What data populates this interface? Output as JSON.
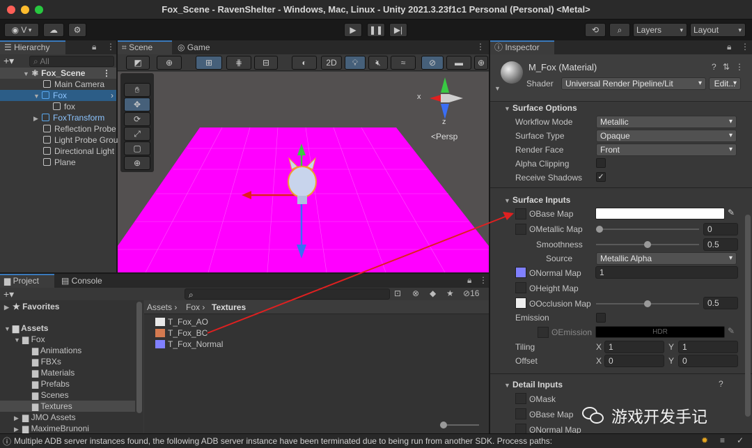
{
  "window_title": "Fox_Scene - RavenShelter - Windows, Mac, Linux - Unity 2021.3.23f1c1 Personal (Personal) <Metal>",
  "toolbar": {
    "account": "V",
    "layers": "Layers",
    "layout": "Layout"
  },
  "hierarchy": {
    "tab": "Hierarchy",
    "search_placeholder": "All",
    "scene": "Fox_Scene",
    "items": [
      "Main Camera",
      "Fox",
      "fox",
      "FoxTransform",
      "Reflection Probe",
      "Light Probe Grou",
      "Directional Light",
      "Plane"
    ]
  },
  "scene": {
    "tab_scene": "Scene",
    "tab_game": "Game",
    "mode_2d": "2D",
    "persp": "<Persp",
    "axis_x": "x",
    "axis_z": "z"
  },
  "project": {
    "tab_project": "Project",
    "tab_console": "Console",
    "hidden_count": "16",
    "favorites": "Favorites",
    "assets": "Assets",
    "tree": [
      "Fox",
      "Animations",
      "FBXs",
      "Materials",
      "Prefabs",
      "Scenes",
      "Textures",
      "JMO Assets",
      "MaximeBrunoni"
    ],
    "breadcrumb": [
      "Assets",
      "Fox",
      "Textures"
    ],
    "files": [
      "T_Fox_AO",
      "T_Fox_BC",
      "T_Fox_Normal"
    ]
  },
  "inspector": {
    "tab": "Inspector",
    "material_name": "M_Fox (Material)",
    "shader_label": "Shader",
    "shader_value": "Universal Render Pipeline/Lit",
    "edit_button": "Edit...",
    "surface_options": "Surface Options",
    "workflow_mode_label": "Workflow Mode",
    "workflow_mode_value": "Metallic",
    "surface_type_label": "Surface Type",
    "surface_type_value": "Opaque",
    "render_face_label": "Render Face",
    "render_face_value": "Front",
    "alpha_clipping_label": "Alpha Clipping",
    "receive_shadows_label": "Receive Shadows",
    "surface_inputs": "Surface Inputs",
    "base_map": "Base Map",
    "metallic_map": "Metallic Map",
    "metallic_value": "0",
    "metallic_level": 0,
    "smoothness": "Smoothness",
    "smoothness_value": "0.5",
    "smoothness_level": 0.5,
    "source_label": "Source",
    "source_value": "Metallic Alpha",
    "normal_map": "Normal Map",
    "normal_value": "1",
    "height_map": "Height Map",
    "occlusion_map": "Occlusion Map",
    "occlusion_value": "0.5",
    "occlusion_level": 0.5,
    "emission": "Emission",
    "emission_map": "Emission M",
    "hdr": "HDR",
    "tiling": "Tiling",
    "offset": "Offset",
    "x": "X",
    "y": "Y",
    "tiling_x": "1",
    "tiling_y": "1",
    "offset_x": "0",
    "offset_y": "0",
    "detail_inputs": "Detail Inputs",
    "mask": "Mask",
    "detail_base_map": "Base Map",
    "detail_normal_map": "Normal Map"
  },
  "watermark": "游戏开发手记",
  "status": "Multiple ADB server instances found, the following ADB server instance have been terminated due to being run from another SDK. Process paths:",
  "colors": {
    "plane": "#ff00ff",
    "accent": "#3a79bb",
    "arrow": "#e02020"
  }
}
